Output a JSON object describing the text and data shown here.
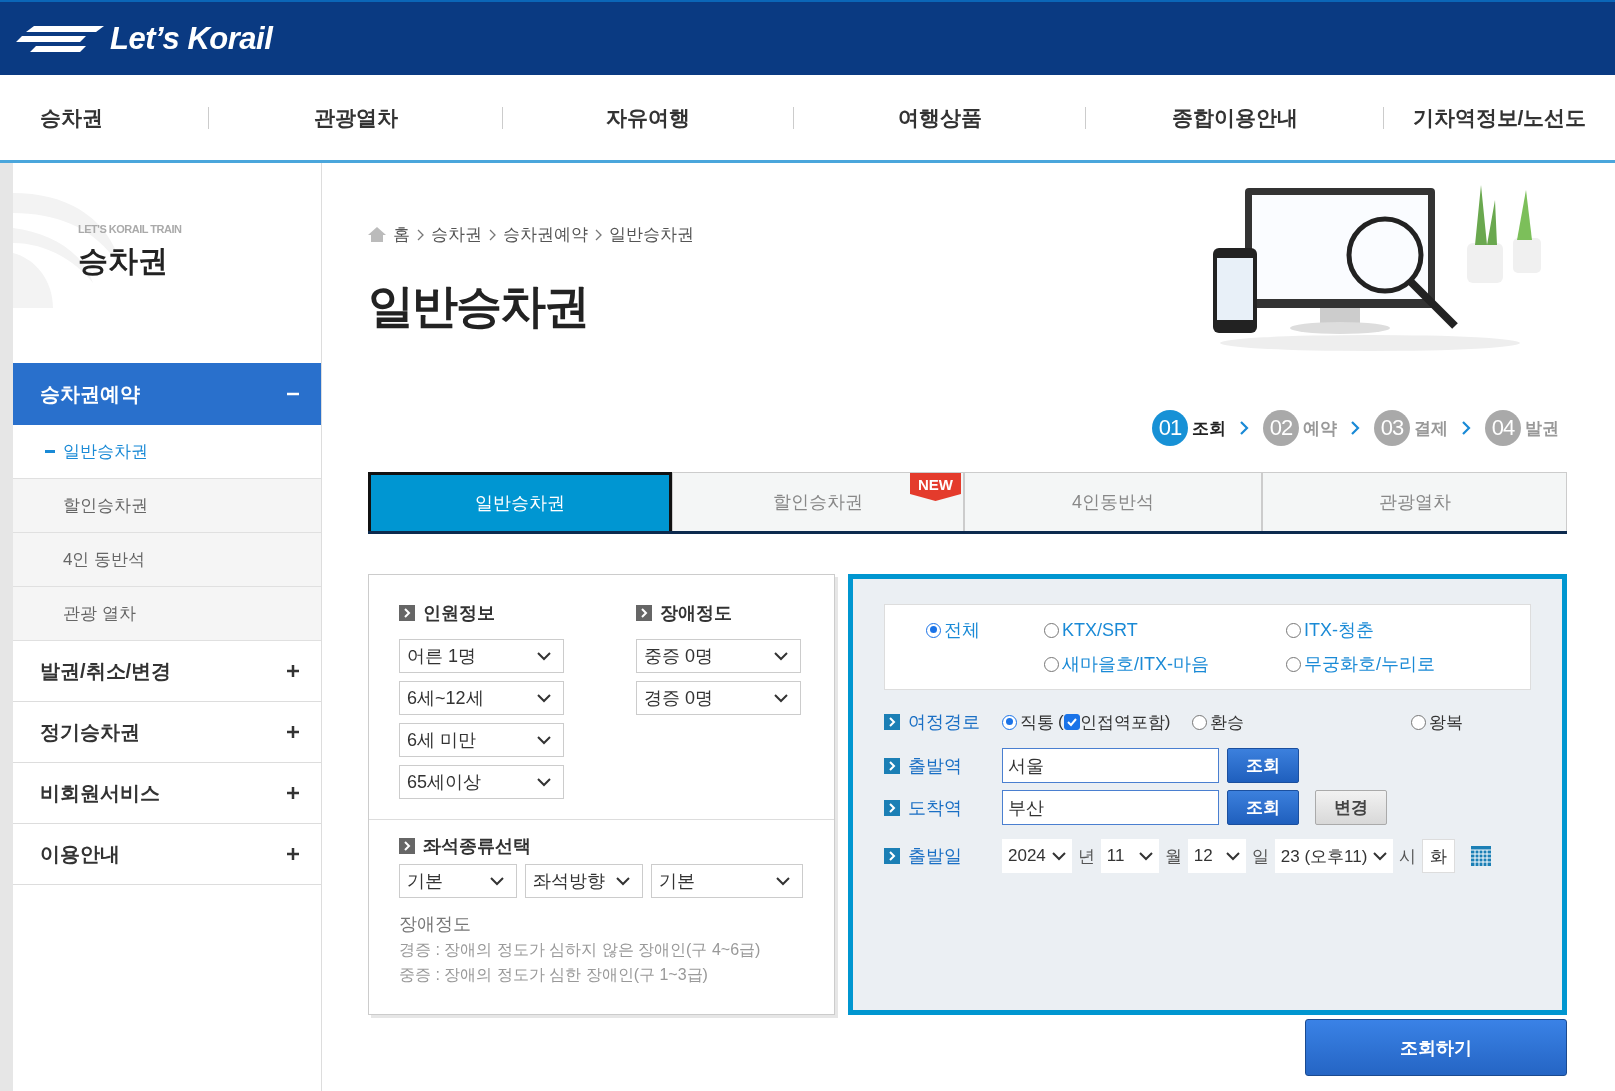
{
  "header": {
    "logo": "Let’s Korail"
  },
  "nav": [
    "승차권",
    "관광열차",
    "자유여행",
    "여행상품",
    "종합이용안내",
    "기차역정보/노선도"
  ],
  "sidebar": {
    "subtitle": "LET'S KORAIL TRAIN",
    "title": "승차권",
    "menu": [
      {
        "label": "승차권예약",
        "expanded": true,
        "children": [
          {
            "label": "일반승차권",
            "selected": true
          },
          {
            "label": "할인승차권",
            "selected": false
          },
          {
            "label": "4인 동반석",
            "selected": false
          },
          {
            "label": "관광 열차",
            "selected": false
          }
        ]
      },
      {
        "label": "발권/취소/변경",
        "expanded": false
      },
      {
        "label": "정기승차권",
        "expanded": false
      },
      {
        "label": "비회원서비스",
        "expanded": false
      },
      {
        "label": "이용안내",
        "expanded": false
      }
    ]
  },
  "breadcrumb": [
    "홈",
    "승차권",
    "승차권예약",
    "일반승차권"
  ],
  "page_title": "일반승차권",
  "illustration": {
    "kind": "picture"
  },
  "steps": [
    {
      "number": "01",
      "label": "조회",
      "selected": true
    },
    {
      "number": "02",
      "label": "예약",
      "selected": false
    },
    {
      "number": "03",
      "label": "결제",
      "selected": false
    },
    {
      "number": "04",
      "label": "발권",
      "selected": false
    }
  ],
  "tabs": [
    {
      "label": "일반승차권",
      "selected": true
    },
    {
      "label": "할인승차권",
      "selected": false,
      "badge": "NEW"
    },
    {
      "label": "4인동반석",
      "selected": false
    },
    {
      "label": "관광열차",
      "selected": false
    }
  ],
  "passengers": {
    "title": "인원정보",
    "selects": [
      "어른 1명",
      "6세~12세",
      "6세 미만",
      "65세이상"
    ]
  },
  "disability": {
    "title": "장애정도",
    "selects": [
      "중증 0명",
      "경증 0명"
    ]
  },
  "seat": {
    "title": "좌석종류선택",
    "selects": [
      "기본",
      "좌석방향",
      "기본"
    ]
  },
  "notes": {
    "title": "장애정도",
    "lines": [
      "경증 : 장애의 정도가 심하지 않은 장애인(구 4~6급)",
      "중증 : 장애의 정도가 심한 장애인(구 1~3급)"
    ]
  },
  "train_types": [
    {
      "label": "전체",
      "selected": true
    },
    {
      "label": "KTX/SRT",
      "selected": false
    },
    {
      "label": "ITX-청춘",
      "selected": false
    },
    {
      "label": "새마을호/ITX-마음",
      "selected": false
    },
    {
      "label": "무궁화호/누리로",
      "selected": false
    }
  ],
  "route": {
    "label": "여정경로",
    "options": [
      {
        "label": "직통",
        "selected": true
      },
      {
        "label": "환승",
        "selected": false
      },
      {
        "label": "왕복",
        "selected": false
      }
    ],
    "adjacent": {
      "prefix": "(",
      "label": "인접역포함",
      "suffix": ")",
      "checked": true
    }
  },
  "departure": {
    "label": "출발역",
    "value": "서울",
    "button": "조회"
  },
  "arrival": {
    "label": "도착역",
    "value": "부산",
    "button": "조회",
    "swap_button": "변경"
  },
  "date": {
    "label": "출발일",
    "year": "2024",
    "year_unit": "년",
    "month": "11",
    "month_unit": "월",
    "day": "12",
    "day_unit": "일",
    "hour": "23 (오후11)",
    "hour_unit": "시",
    "weekday": "화"
  },
  "search_button": "조회하기"
}
